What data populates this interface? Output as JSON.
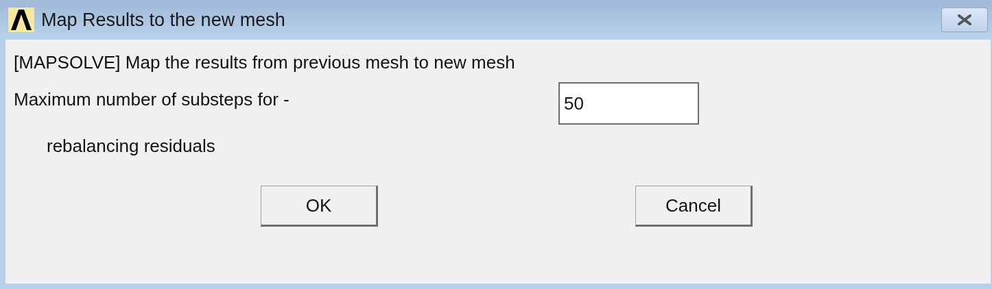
{
  "window": {
    "title": "Map Results to the new mesh"
  },
  "command_description": "[MAPSOLVE]  Map the results from previous mesh to new mesh",
  "field": {
    "label": "Maximum number of substeps for -",
    "label_continuation": "rebalancing residuals",
    "value": "50"
  },
  "buttons": [
    "OK",
    "Cancel"
  ]
}
